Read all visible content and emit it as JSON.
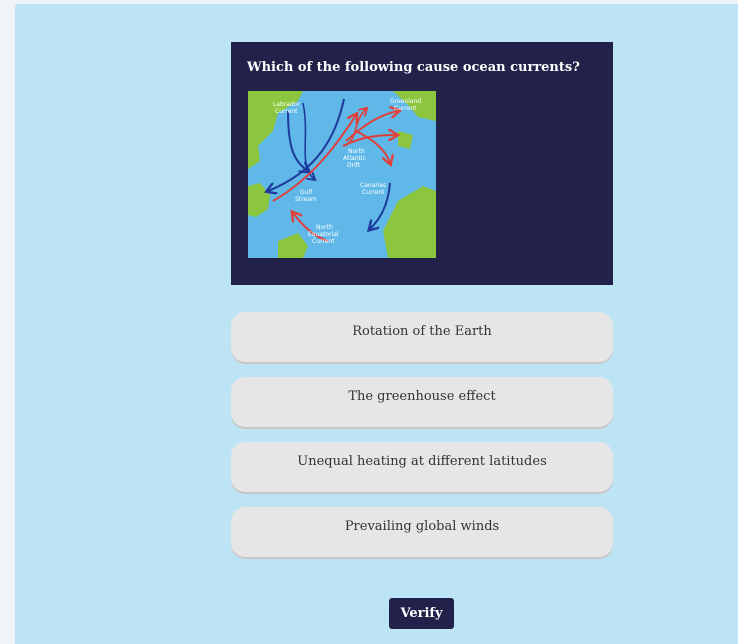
{
  "question": {
    "text": "Which of the following cause ocean currents?",
    "map_labels": {
      "labrador": [
        "Labrador",
        "Current"
      ],
      "greenland": [
        "Greenland",
        "Current"
      ],
      "north_atlantic": [
        "North",
        "Atlantic",
        "Drift"
      ],
      "gulf": [
        "Gulf",
        "Stream"
      ],
      "canaries": [
        "Canaries",
        "Current"
      ],
      "north_equatorial": [
        "North",
        "Equatorial",
        "Current"
      ]
    }
  },
  "answers": [
    {
      "label": "Rotation of the Earth"
    },
    {
      "label": "The greenhouse effect"
    },
    {
      "label": "Unequal heating at different latitudes"
    },
    {
      "label": "Prevailing global winds"
    }
  ],
  "verify_label": "Verify",
  "colors": {
    "panel_bg": "#bde4f5",
    "card_bg": "#22214a",
    "answer_bg": "#e6e6e6",
    "ocean": "#5fb8e8",
    "land": "#8cc63f",
    "warm_current": "#e0403a",
    "cold_current": "#1f3a9c"
  }
}
